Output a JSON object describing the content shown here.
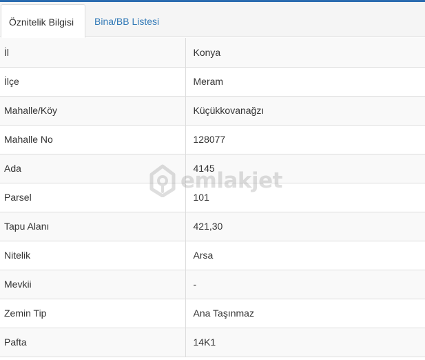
{
  "tabs": [
    {
      "label": "Öznitelik Bilgisi",
      "active": true
    },
    {
      "label": "Bina/BB Listesi",
      "active": false
    }
  ],
  "rows": [
    {
      "key": "İl",
      "value": "Konya"
    },
    {
      "key": "İlçe",
      "value": "Meram"
    },
    {
      "key": "Mahalle/Köy",
      "value": "Küçükkovanağzı"
    },
    {
      "key": "Mahalle No",
      "value": "128077"
    },
    {
      "key": "Ada",
      "value": "4145"
    },
    {
      "key": "Parsel",
      "value": "101"
    },
    {
      "key": "Tapu Alanı",
      "value": "421,30"
    },
    {
      "key": "Nitelik",
      "value": "Arsa"
    },
    {
      "key": "Mevkii",
      "value": "-"
    },
    {
      "key": "Zemin Tip",
      "value": "Ana Taşınmaz"
    },
    {
      "key": "Pafta",
      "value": "14K1"
    }
  ],
  "watermark": {
    "text": "emlakjet",
    "icon": "location-pin-icon"
  },
  "colors": {
    "accent": "#2b6cb0",
    "link": "#337ab7",
    "border": "#dddddd",
    "stripe": "#f9f9f9"
  }
}
